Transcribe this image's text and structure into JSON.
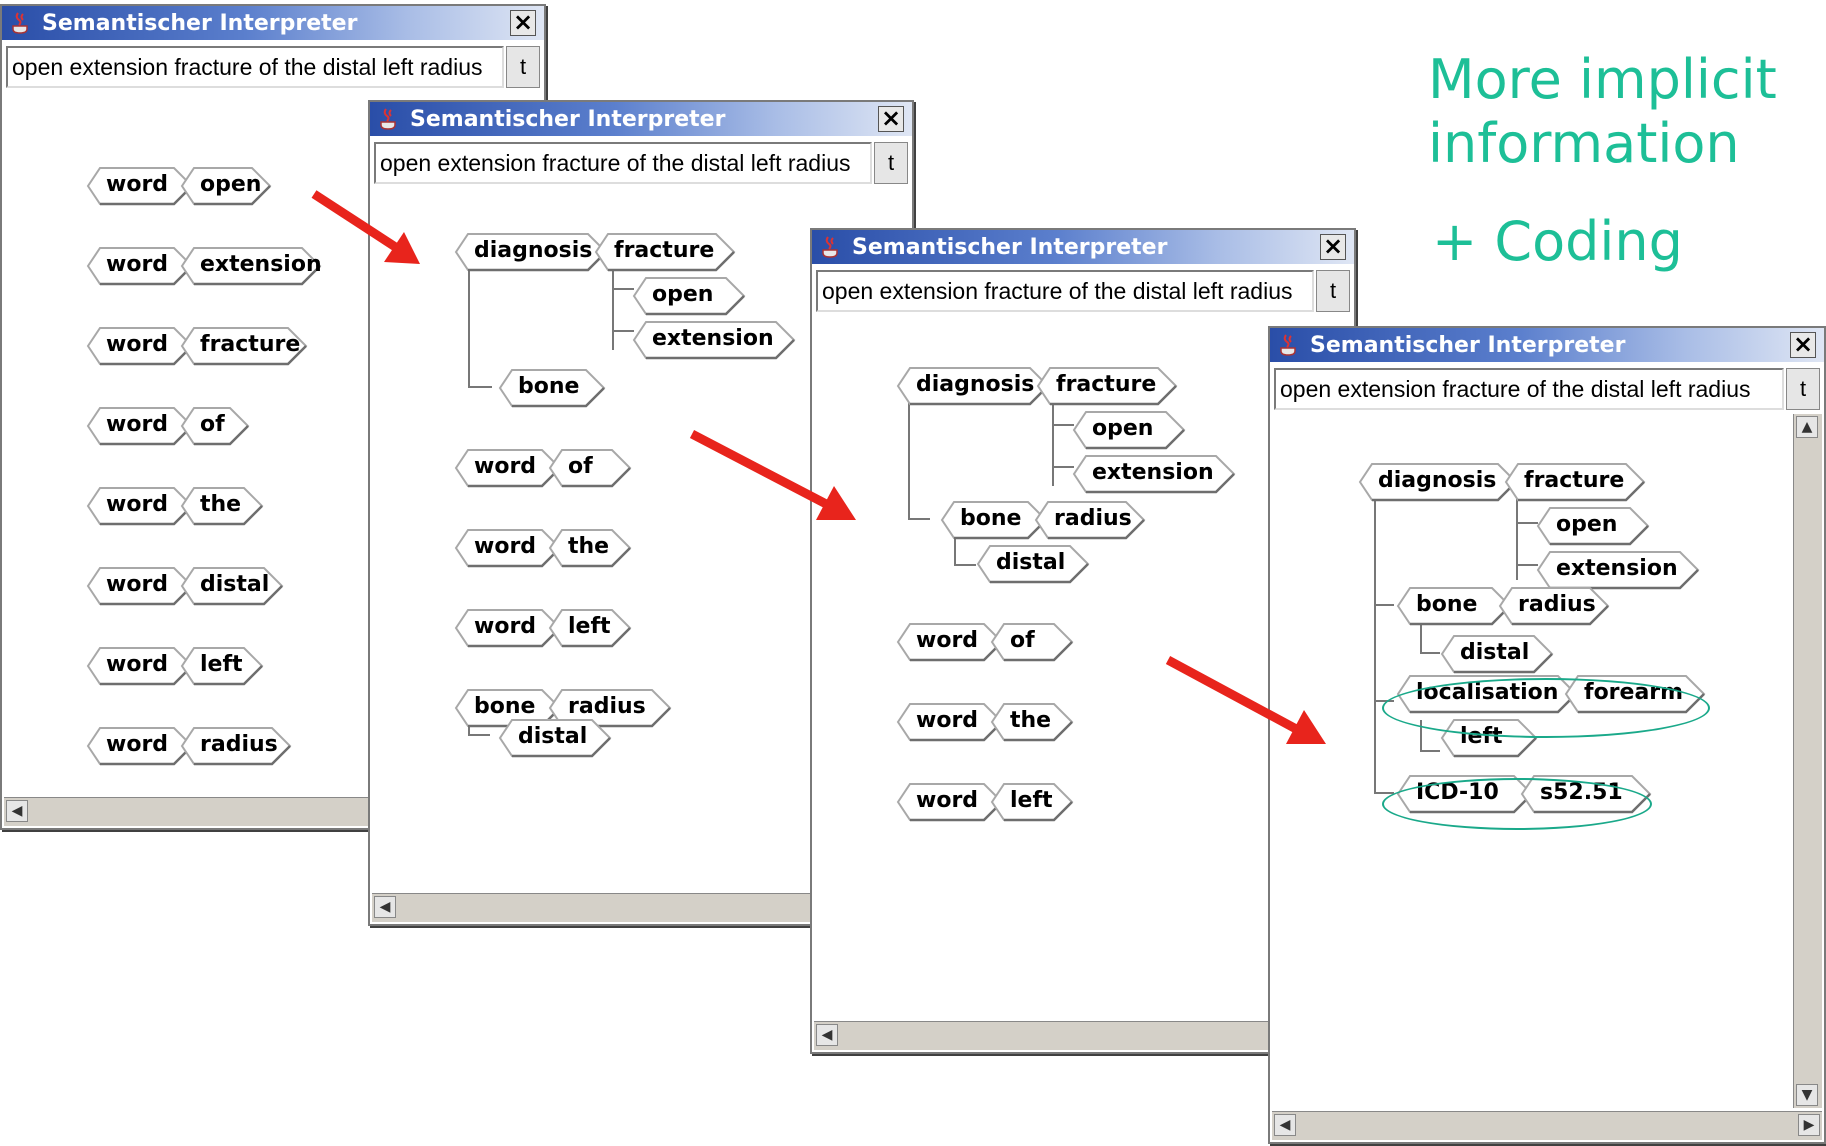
{
  "app": {
    "title": "Semantischer Interpreter",
    "query": "open extension fracture of the distal left radius",
    "t_button": "t",
    "close_label": "✕"
  },
  "annotation": {
    "line1": "More implicit",
    "line2": "information",
    "line3": "+ Coding"
  },
  "win1": {
    "rows": [
      {
        "a": "word",
        "b": "open"
      },
      {
        "a": "word",
        "b": "extension"
      },
      {
        "a": "word",
        "b": "fracture"
      },
      {
        "a": "word",
        "b": "of"
      },
      {
        "a": "word",
        "b": "the"
      },
      {
        "a": "word",
        "b": "distal"
      },
      {
        "a": "word",
        "b": "left"
      },
      {
        "a": "word",
        "b": "radius"
      }
    ]
  },
  "win2": {
    "diagnosis": "diagnosis",
    "fracture": "fracture",
    "open": "open",
    "extension": "extension",
    "bone": "bone",
    "rows": [
      {
        "a": "word",
        "b": "of"
      },
      {
        "a": "word",
        "b": "the"
      },
      {
        "a": "word",
        "b": "left"
      }
    ],
    "bone2": "bone",
    "radius": "radius",
    "distal": "distal"
  },
  "win3": {
    "diagnosis": "diagnosis",
    "fracture": "fracture",
    "open": "open",
    "extension": "extension",
    "bone": "bone",
    "radius": "radius",
    "distal": "distal",
    "rows": [
      {
        "a": "word",
        "b": "of"
      },
      {
        "a": "word",
        "b": "the"
      },
      {
        "a": "word",
        "b": "left"
      }
    ]
  },
  "win4": {
    "diagnosis": "diagnosis",
    "fracture": "fracture",
    "open": "open",
    "extension": "extension",
    "bone": "bone",
    "radius": "radius",
    "distal": "distal",
    "localisation": "localisation",
    "forearm": "forearm",
    "left": "left",
    "icd": "ICD-10",
    "code": "s52.51"
  },
  "colors": {
    "arrow": "#e8241c",
    "annotation": "#1dbf97",
    "highlight": "#1aa98a",
    "titlebar": "#2a4ea8"
  }
}
